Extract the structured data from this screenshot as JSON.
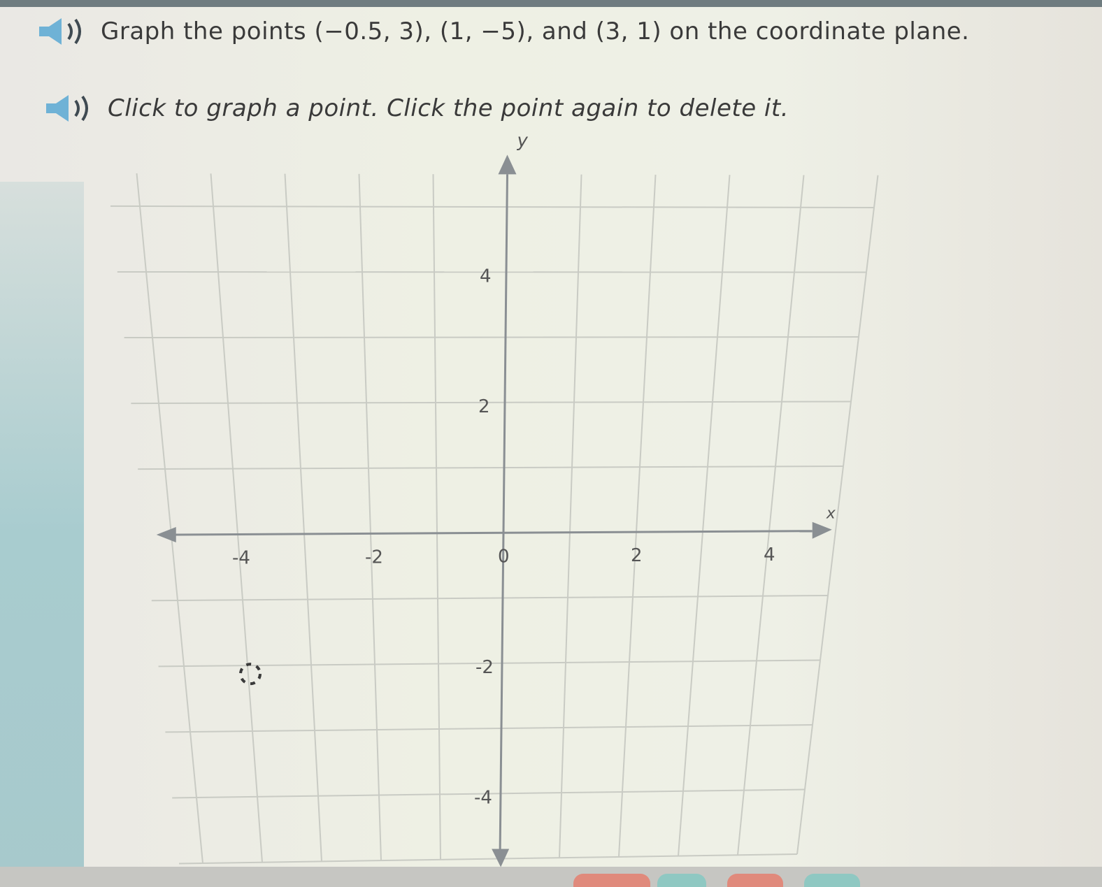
{
  "prompt": {
    "instruction_prefix": "Graph the points ",
    "point_1": "(−0.5, 3)",
    "sep_1": ", ",
    "point_2": "(1, −5)",
    "sep_2": ", and ",
    "point_3": "(3, 1)",
    "instruction_suffix": " on the coordinate plane.",
    "hint": "Click to graph a point. Click the point again to delete it."
  },
  "graph": {
    "x_axis_label": "x",
    "y_axis_label": "y",
    "x_min": -5,
    "x_max": 5,
    "y_min": -5,
    "y_max": 5,
    "grid_step": 1,
    "x_tick_labels": [
      {
        "value": -4,
        "text": "-4"
      },
      {
        "value": -2,
        "text": "-2"
      },
      {
        "value": 0,
        "text": "0"
      },
      {
        "value": 2,
        "text": "2"
      },
      {
        "value": 4,
        "text": "4"
      }
    ],
    "y_tick_labels": [
      {
        "value": 4,
        "text": "4"
      },
      {
        "value": 2,
        "text": "2"
      },
      {
        "value": -2,
        "text": "-2"
      },
      {
        "value": -4,
        "text": "-4"
      }
    ],
    "plotted_points": [],
    "cursor_position": {
      "x": -4,
      "y": -2
    }
  },
  "colors": {
    "grid": "#c9cbc4",
    "axis": "#8a8f93",
    "audio_icon": "#6fb2d6",
    "tabs": [
      "#e08a7c",
      "#8fc8c2",
      "#e08a7c",
      "#8fc8c2"
    ]
  }
}
